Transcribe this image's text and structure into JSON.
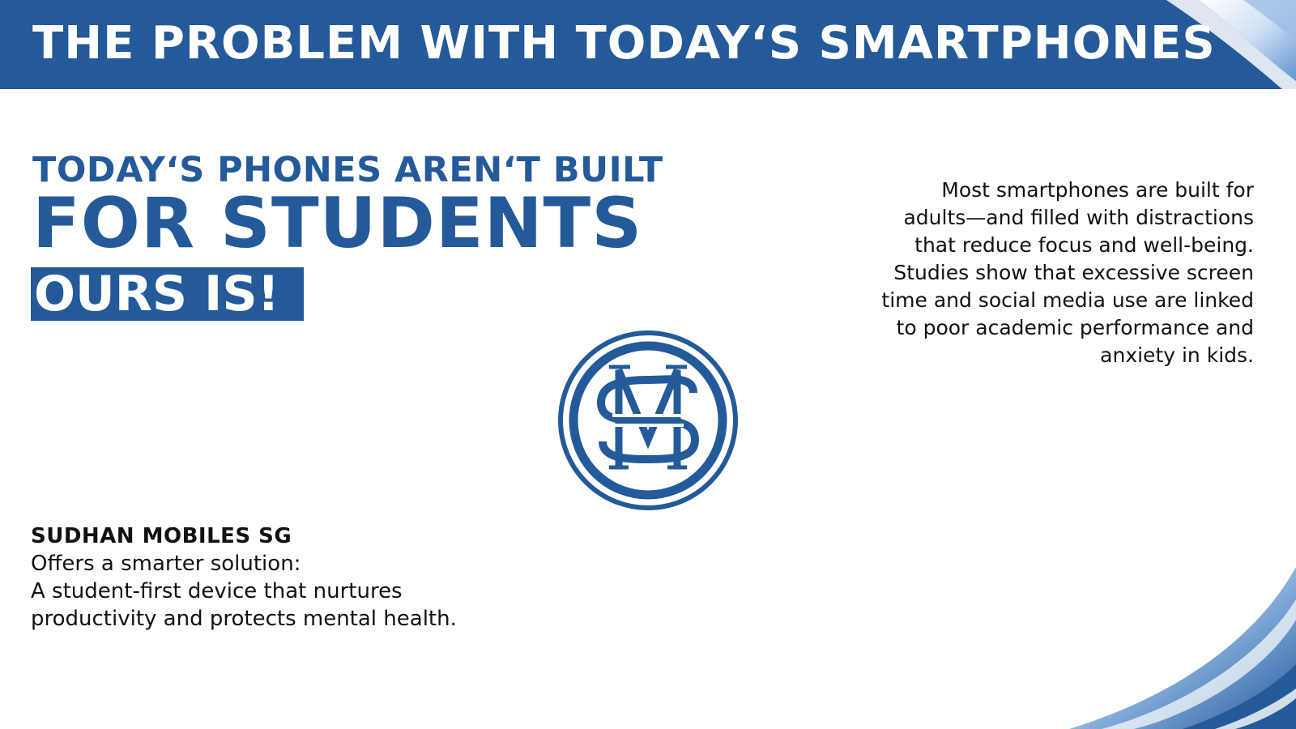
{
  "slide": {
    "title": "THE PROBLEM WITH TODAY‘S SMARTPHONES",
    "headline_line1": "TODAY‘S PHONES AREN‘T BUILT",
    "headline_line2": "FOR STUDENTS",
    "headline_highlight": "OURS IS!",
    "right_paragraph_lines": [
      "Most smartphones are built for",
      "adults—and filled with distractions",
      "that reduce focus and well-being.",
      "Studies show that excessive screen",
      "time and social media use are linked",
      "to poor academic performance and",
      "anxiety in kids."
    ],
    "company_name": "SUDHAN MOBILES SG",
    "left_paragraph_lines": [
      "Offers a smarter solution:",
      "A student-first device that nurtures",
      "productivity and protects mental health."
    ],
    "logo_icon": "sm-monogram-logo-icon"
  },
  "colors": {
    "brand_blue": "#245a99",
    "background": "#ffffff",
    "text": "#111111"
  }
}
